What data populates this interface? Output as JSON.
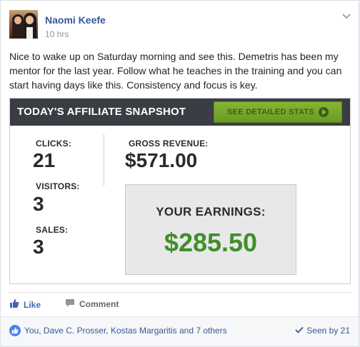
{
  "post": {
    "author": "Naomi Keefe",
    "time": "10 hrs",
    "text": "Nice to wake up on Saturday morning and see this. Demetris has been my mentor for the last year. Follow what he teaches in the training and you can start having days like this. Consistency and focus is key."
  },
  "snapshot": {
    "title": "TODAY'S AFFILIATE SNAPSHOT",
    "button_label": "SEE DETAILED STATS",
    "clicks_label": "CLICKS:",
    "clicks_value": "21",
    "visitors_label": "VISITORS:",
    "visitors_value": "3",
    "sales_label": "SALES:",
    "sales_value": "3",
    "gross_label": "GROSS REVENUE:",
    "gross_value": "$571.00",
    "earnings_label": "YOUR EARNINGS:",
    "earnings_value": "$285.50"
  },
  "actions": {
    "like_label": "Like",
    "comment_label": "Comment"
  },
  "footer": {
    "reactions_text": "You, Dave C. Prosser, Kostas Margaritis and 7 others",
    "seen_text": "Seen by 21"
  },
  "colors": {
    "link_blue": "#365899",
    "earnings_green": "#3f8f2a",
    "bar_dark": "#3a3d44",
    "button_green": "#7aa82c"
  }
}
